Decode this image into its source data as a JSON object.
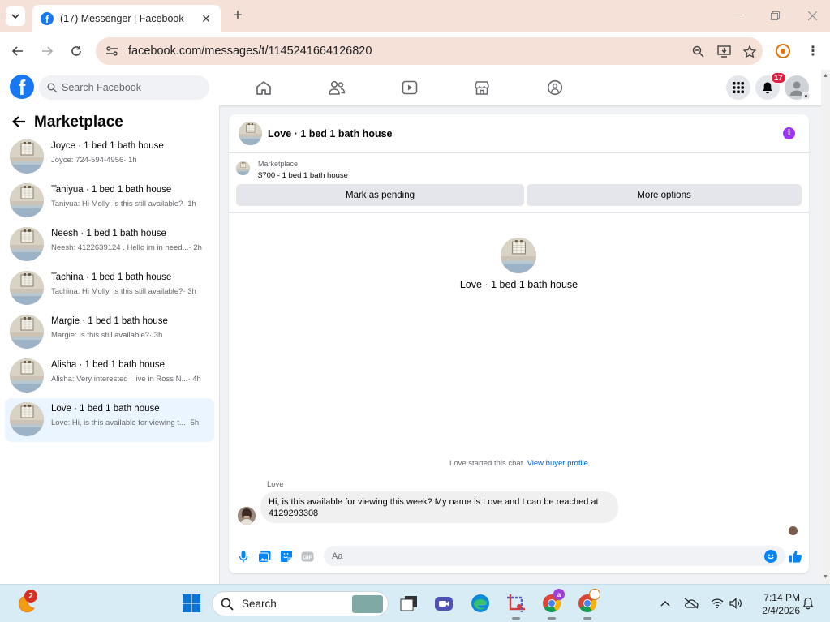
{
  "browser": {
    "tab_title": "(17) Messenger | Facebook",
    "url": "facebook.com/messages/t/1145241664126820",
    "favicon_letter": "f"
  },
  "facebook": {
    "logo_letter": "f",
    "search_placeholder": "Search Facebook",
    "notification_count": "17",
    "nav_icons": [
      "home-icon",
      "friends-icon",
      "video-icon",
      "marketplace-icon",
      "groups-icon"
    ]
  },
  "sidebar": {
    "title": "Marketplace",
    "conversations": [
      {
        "name": "Joyce · 1 bed 1 bath house",
        "snippet": "Joyce: 724-594-4956",
        "time": "· 1h",
        "active": false
      },
      {
        "name": "Taniyua · 1 bed 1 bath house",
        "snippet": "Taniyua: Hi Molly, is this still available?",
        "time": "· 1h",
        "active": false
      },
      {
        "name": "Neesh · 1 bed 1 bath house",
        "snippet": "Neesh: 4122639124 . Hello im in need...",
        "time": "· 2h",
        "active": false
      },
      {
        "name": "Tachina · 1 bed 1 bath house",
        "snippet": "Tachina: Hi Molly, is this still available?",
        "time": "· 3h",
        "active": false
      },
      {
        "name": "Margie · 1 bed 1 bath house",
        "snippet": "Margie: Is this still available?",
        "time": "· 3h",
        "active": false
      },
      {
        "name": "Alisha · 1 bed 1 bath house",
        "snippet": "Alisha: Very interested I live in Ross N...",
        "time": "· 4h",
        "active": false
      },
      {
        "name": "Love · 1 bed 1 bath house",
        "snippet": "Love: Hi, is this available for viewing t...",
        "time": "· 5h",
        "active": true
      }
    ]
  },
  "chat": {
    "title": "Love · 1 bed 1 bath house",
    "listing_label": "Marketplace",
    "listing_price": "$700 - 1 bed 1 bath house",
    "mark_pending_label": "Mark as pending",
    "more_options_label": "More options",
    "center_name": "Love · 1 bed 1 bath house",
    "started_text": "Love started this chat.",
    "view_profile_label": "View buyer profile",
    "sender_name": "Love",
    "message_line1": "Hi, is this available for viewing this week? My name is Love and I can be reached at",
    "message_line2": "4129293308",
    "composer_placeholder": "Aa",
    "accent_color": "#0084ff"
  },
  "taskbar": {
    "weather_badge": "2",
    "search_label": "Search",
    "time": "7:14 PM",
    "date": "2/4/2026",
    "chrome_profile_badge": "a"
  }
}
